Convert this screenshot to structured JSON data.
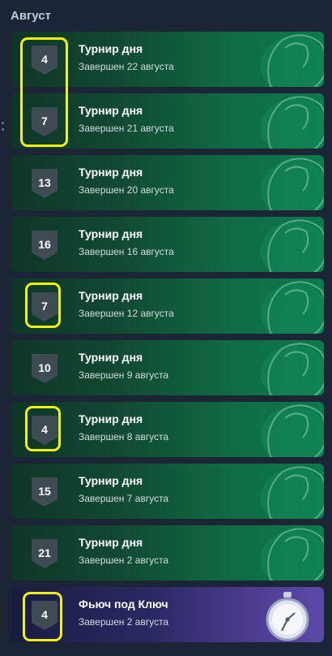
{
  "section": {
    "title": "Август"
  },
  "items": [
    {
      "place": "4",
      "title": "Турнир дня",
      "status": "Завершен 22 августа",
      "highlighted": true
    },
    {
      "place": "7",
      "title": "Турнир дня",
      "status": "Завершен 21 августа",
      "highlighted": true
    },
    {
      "place": "13",
      "title": "Турнир дня",
      "status": "Завершен 20 августа",
      "highlighted": false
    },
    {
      "place": "16",
      "title": "Турнир дня",
      "status": "Завершен 16 августа",
      "highlighted": false
    },
    {
      "place": "7",
      "title": "Турнир дня",
      "status": "Завершен 12 августа",
      "highlighted": true
    },
    {
      "place": "10",
      "title": "Турнир дня",
      "status": "Завершен 9 августа",
      "highlighted": false
    },
    {
      "place": "4",
      "title": "Турнир дня",
      "status": "Завершен 8 августа",
      "highlighted": true
    },
    {
      "place": "15",
      "title": "Турнир дня",
      "status": "Завершен 7 августа",
      "highlighted": false
    },
    {
      "place": "21",
      "title": "Турнир дня",
      "status": "Завершен 2 августа",
      "highlighted": false
    },
    {
      "place": "4",
      "title": "Фьюч под Ключ",
      "status": "Завершен 2 августа",
      "highlighted": true
    }
  ],
  "colors": {
    "highlight": "#f2f20c",
    "badge": "#3f4b52",
    "card_green": "#0f6b44",
    "card_purple": "#4a3b8e"
  },
  "icons": {
    "daily_card": "boxing-glove-icon",
    "special_card": "stopwatch-icon",
    "place_badge": "shield-badge-icon"
  }
}
